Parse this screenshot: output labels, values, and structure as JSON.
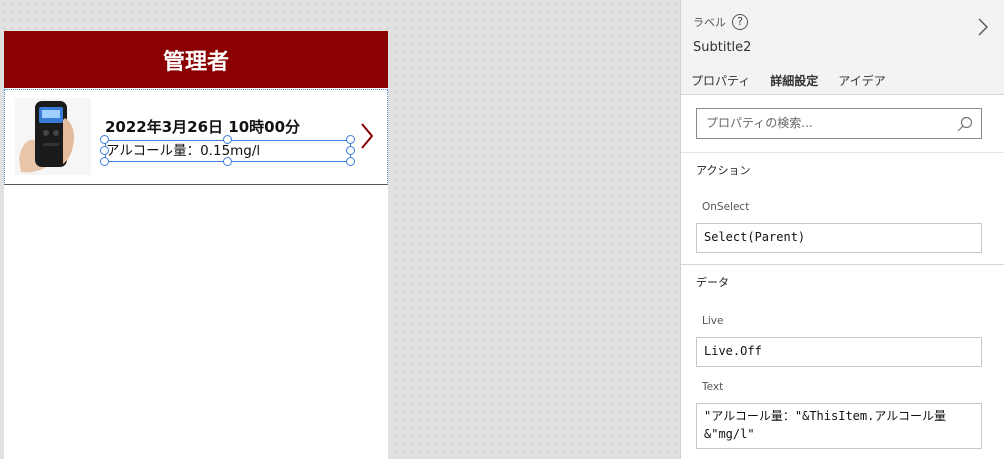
{
  "app": {
    "header_title": "管理者",
    "gallery": {
      "item_title": "2022年3月26日 10時00分",
      "item_subtitle": "アルコール量：0.15mg/l",
      "thumb_icon": "breathalyzer-photo",
      "chevron_icon": "chevron-right-icon"
    },
    "colors": {
      "header_bg": "#8b0000",
      "selection": "#3b7ddd",
      "chevron": "#8b0000"
    }
  },
  "panel": {
    "control_type": "ラベル",
    "help_icon_text": "?",
    "control_name": "Subtitle2",
    "tabs": [
      {
        "label": "プロパティ",
        "active": false
      },
      {
        "label": "詳細設定",
        "active": true
      },
      {
        "label": "アイデア",
        "active": false
      }
    ],
    "search": {
      "placeholder": "プロパティの検索..."
    },
    "sections": {
      "actions": {
        "title": "アクション",
        "onselect_label": "OnSelect",
        "onselect_value": "Select(Parent)"
      },
      "data": {
        "title": "データ",
        "live_label": "Live",
        "live_value": "Live.Off",
        "text_label": "Text",
        "text_value_line1": "\"アルコール量：\"&ThisItem.アルコール量",
        "text_value_line2": "&\"mg/l\""
      }
    }
  }
}
